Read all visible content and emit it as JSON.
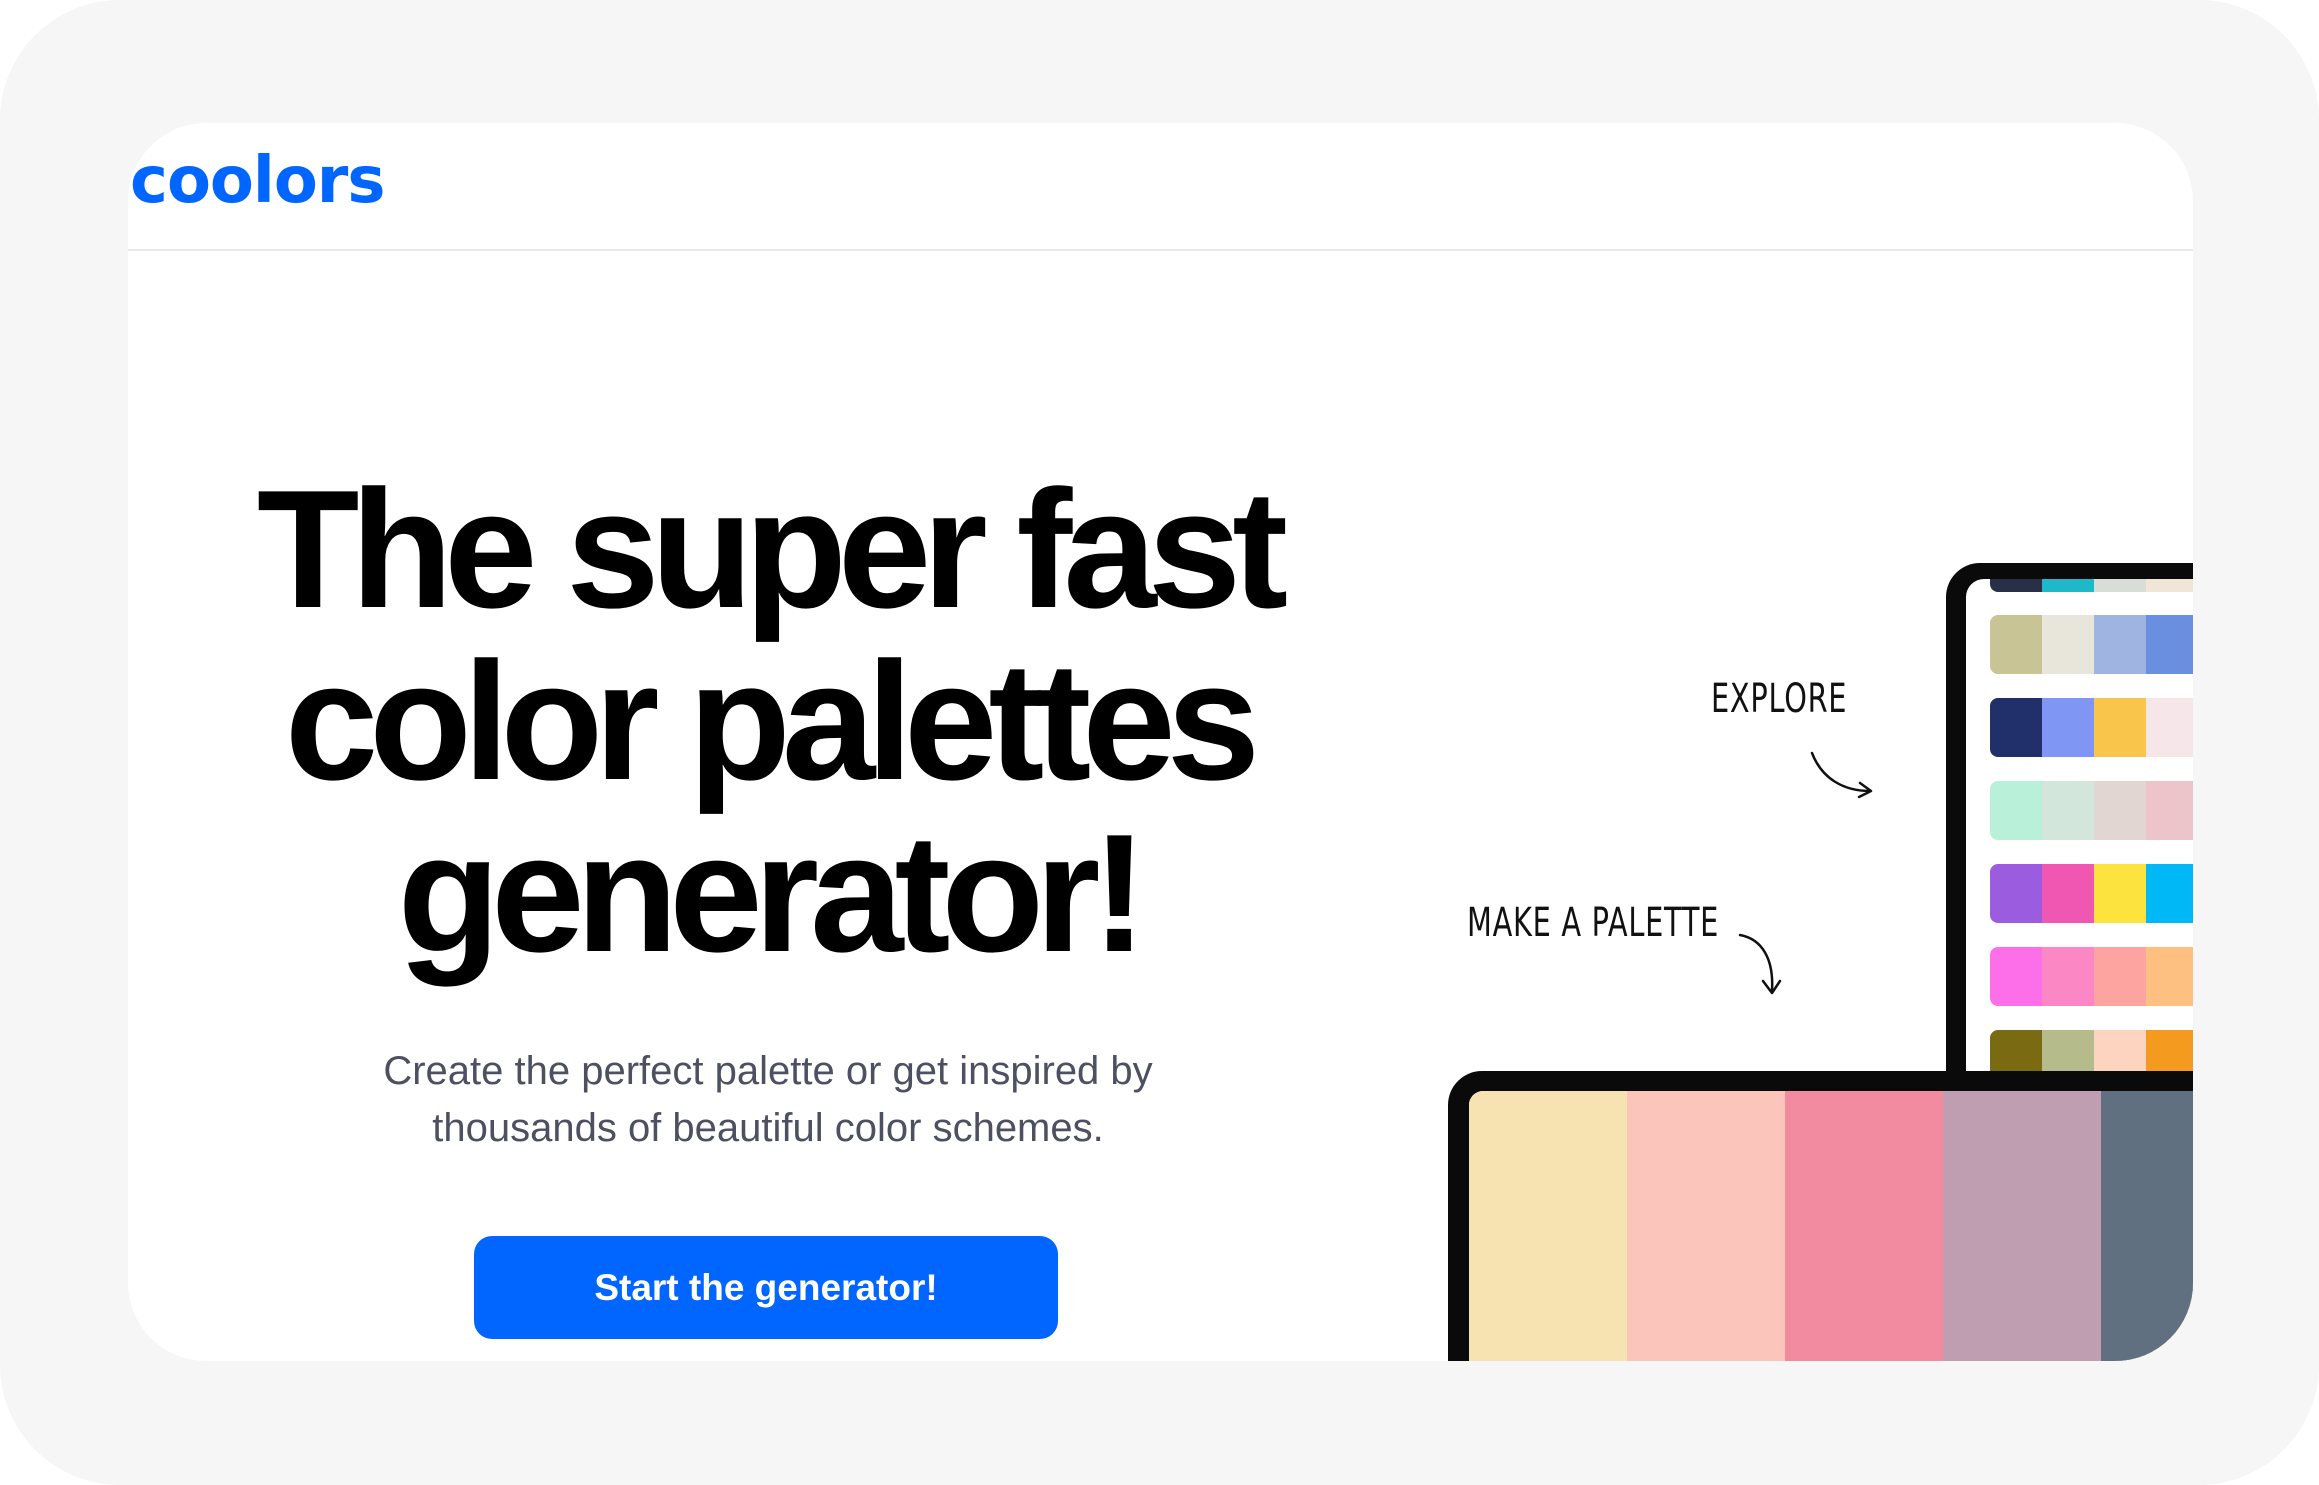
{
  "header": {
    "logo_text": "coolors"
  },
  "hero": {
    "title_lines": [
      "The super fast",
      "color palettes",
      "generator!"
    ],
    "subtitle_lines": [
      "Create the perfect palette or get inspired by",
      "thousands of beautiful color schemes."
    ],
    "cta_label": "Start the generator!"
  },
  "illustration": {
    "explore_label": "EXPLORE",
    "make_palette_label": "MAKE A PALETTE",
    "phone_palettes": [
      [
        "#c9c495",
        "#e8e6da",
        "#9fb4e1",
        "#6a8fe0",
        "#3b5fb8"
      ],
      [
        "#21306b",
        "#7f96f5",
        "#f9c54a",
        "#f6e6ea",
        "#ef8aa3"
      ],
      [
        "#b9f0d9",
        "#d3e6dc",
        "#e2d6d3",
        "#edc4c9",
        "#f2b0ba"
      ],
      [
        "#9b5ce0",
        "#f057b3",
        "#fce33d",
        "#00b8f5",
        "#18d3c4"
      ],
      [
        "#fd6fe8",
        "#fb87c4",
        "#fda3a0",
        "#fec080",
        "#fdd24a"
      ],
      [
        "#7a6a12",
        "#b5bb8a",
        "#fcd4c0",
        "#f39a1f",
        "#e45d17"
      ]
    ],
    "laptop_palette": [
      "#f7e2b2",
      "#fbc5bc",
      "#f28aa0",
      "#c09eb2",
      "#607080"
    ]
  },
  "colors": {
    "brand_blue": "#0066ff",
    "heading": "#000000",
    "subtitle": "#4d5060"
  }
}
